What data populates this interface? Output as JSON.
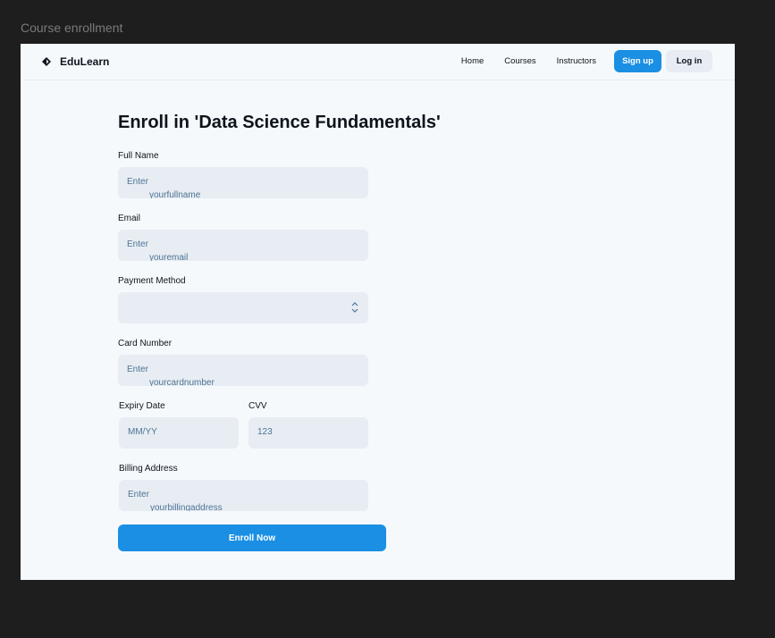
{
  "window": {
    "title": "Course enrollment"
  },
  "nav": {
    "brand": "EduLearn",
    "links": [
      "Home",
      "Courses",
      "Instructors"
    ],
    "signup_label": "Sign up",
    "login_label": "Log in"
  },
  "page": {
    "title": "Enroll in 'Data Science Fundamentals'"
  },
  "form": {
    "full_name": {
      "label": "Full Name",
      "placeholder_line1": "Enter",
      "placeholder_line2": "yourfullname"
    },
    "email": {
      "label": "Email",
      "placeholder_line1": "Enter",
      "placeholder_line2": "youremail"
    },
    "payment": {
      "label": "Payment Method",
      "value": ""
    },
    "card": {
      "label": "Card Number",
      "placeholder_line1": "Enter",
      "placeholder_line2": "yourcardnumber"
    },
    "expiry": {
      "label": "Expiry Date",
      "placeholder": "MM/YY"
    },
    "cvv": {
      "label": "CVV",
      "placeholder": "123"
    },
    "billing": {
      "label": "Billing Address",
      "placeholder_line1": "Enter",
      "placeholder_line2": "yourbillingaddress"
    },
    "submit_label": "Enroll Now"
  },
  "icons": {
    "logo": "edulearn-logo-icon",
    "select": "chevron-up-down-icon"
  },
  "colors": {
    "primary": "#1a8fe3",
    "field_bg": "#e7edf2",
    "placeholder": "#4f7396",
    "page_bg": "#f5f9fc"
  }
}
